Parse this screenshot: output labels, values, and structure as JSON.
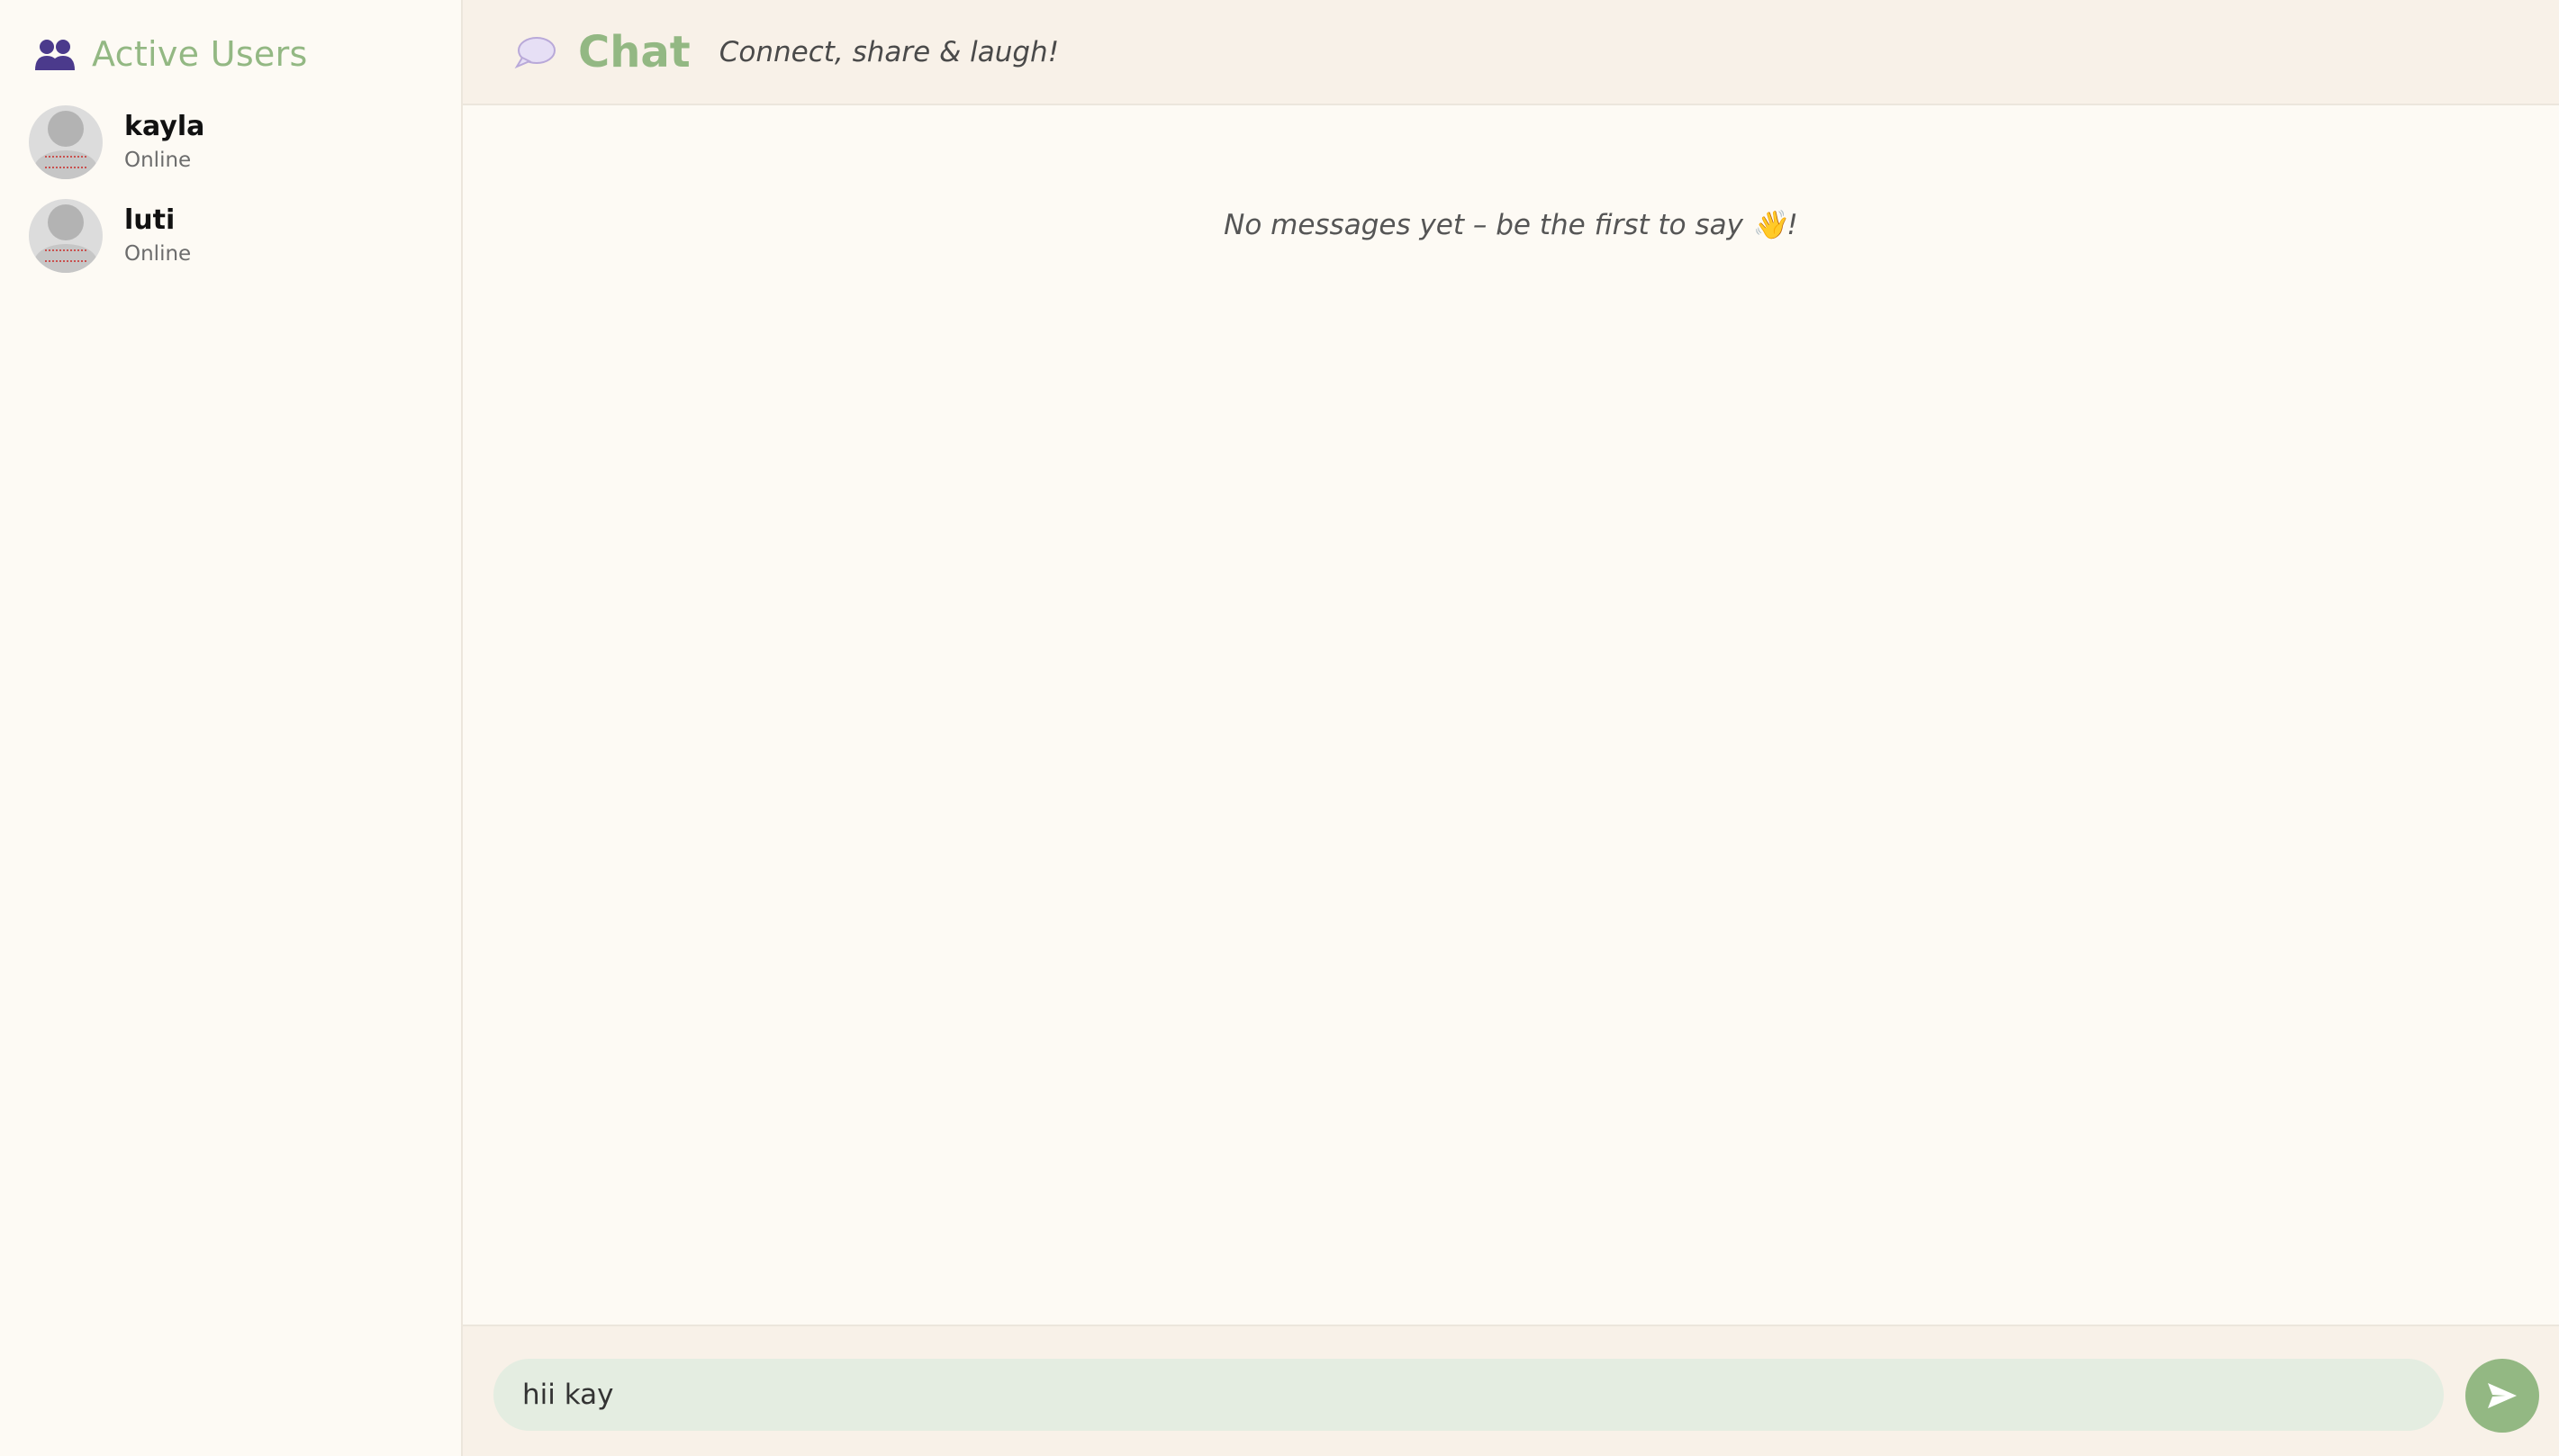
{
  "sidebar": {
    "title": "Active Users",
    "icon": "users-icon",
    "users": [
      {
        "name": "kayla",
        "status": "Online"
      },
      {
        "name": "luti",
        "status": "Online"
      }
    ]
  },
  "header": {
    "icon": "speech-bubble-icon",
    "title": "Chat",
    "tagline": "Connect, share & laugh!"
  },
  "messages": {
    "empty_text": "No messages yet – be the first to say 👋!"
  },
  "composer": {
    "input_value": "hii kay",
    "send_icon": "send-icon"
  },
  "colors": {
    "accent": "#93b883",
    "sidebar_bg": "#fdfaf4",
    "header_bg": "#f8f1e8",
    "input_bg": "#e4ede1",
    "icon_purple": "#4b3a8c"
  }
}
